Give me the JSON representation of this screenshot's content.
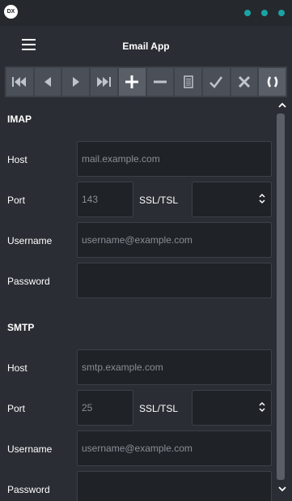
{
  "app": {
    "logo_text": "DX",
    "title": "Email App"
  },
  "toolbar": {
    "buttons": [
      {
        "name": "first-record",
        "icon": "skip-first-icon"
      },
      {
        "name": "previous-record",
        "icon": "chevron-left-icon"
      },
      {
        "name": "next-record",
        "icon": "chevron-right-icon"
      },
      {
        "name": "last-record",
        "icon": "skip-last-icon"
      },
      {
        "name": "add",
        "icon": "plus-icon"
      },
      {
        "name": "remove",
        "icon": "minus-icon"
      },
      {
        "name": "edit",
        "icon": "document-icon"
      },
      {
        "name": "apply",
        "icon": "check-icon"
      },
      {
        "name": "cancel",
        "icon": "x-icon"
      },
      {
        "name": "refresh",
        "icon": "refresh-icon"
      }
    ]
  },
  "imap": {
    "title": "IMAP",
    "host_label": "Host",
    "host_placeholder": "mail.example.com",
    "port_label": "Port",
    "port_placeholder": "143",
    "ssl_label": "SSL/TSL",
    "username_label": "Username",
    "username_placeholder": "username@example.com",
    "password_label": "Password"
  },
  "smtp": {
    "title": "SMTP",
    "host_label": "Host",
    "host_placeholder": "smtp.example.com",
    "port_label": "Port",
    "port_placeholder": "25",
    "ssl_label": "SSL/TSL",
    "username_label": "Username",
    "username_placeholder": "username@example.com",
    "password_label": "Password"
  },
  "colors": {
    "background": "#2a2d33",
    "titlebar": "#25282d",
    "accent_dots": "#1aa3a3",
    "field_bg": "#1f2227"
  }
}
